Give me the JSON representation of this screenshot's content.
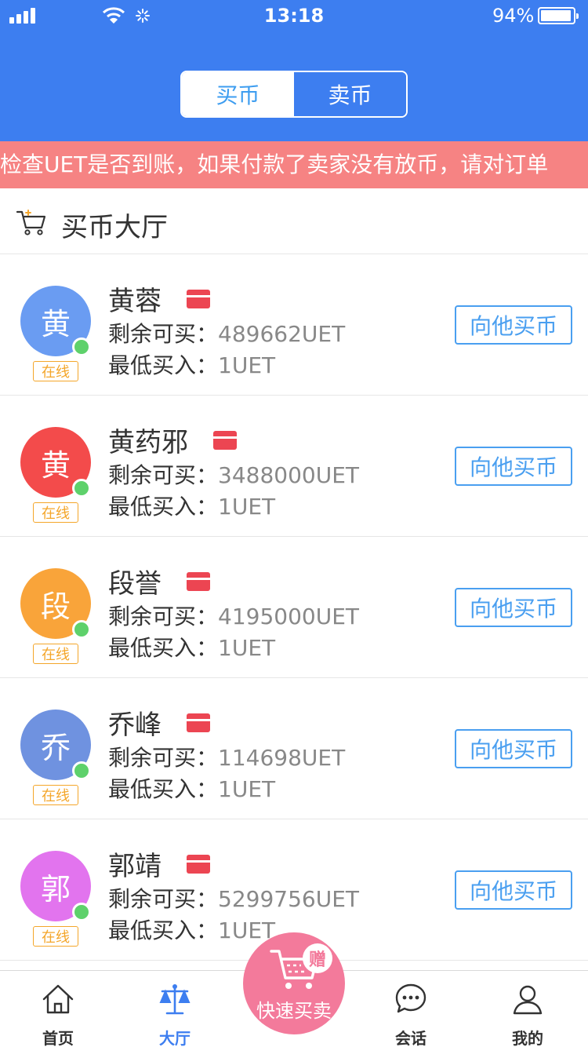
{
  "status_bar": {
    "time": "13:18",
    "battery_text": "94%",
    "battery_level": 0.94
  },
  "segment": {
    "buy_label": "买币",
    "sell_label": "卖币",
    "selected": "sell"
  },
  "notice": {
    "text": "检查UET是否到账，如果付款了卖家没有放币，请对订单"
  },
  "hall": {
    "title": "买币大厅",
    "icon": "cart-icon"
  },
  "labels": {
    "remaining": "剩余可买：",
    "min_buy": "最低买入：",
    "online": "在线",
    "buy_button": "向他买币"
  },
  "sellers": [
    {
      "avatar_char": "黄",
      "avatar_color": "#6a9cf2",
      "name": "黄蓉",
      "remaining": "489662UET",
      "min_buy": "1UET"
    },
    {
      "avatar_char": "黄",
      "avatar_color": "#f34b4b",
      "name": "黄药邪",
      "remaining": "3488000UET",
      "min_buy": "1UET"
    },
    {
      "avatar_char": "段",
      "avatar_color": "#f9a43a",
      "name": "段誉",
      "remaining": "4195000UET",
      "min_buy": "1UET"
    },
    {
      "avatar_char": "乔",
      "avatar_color": "#6f92e0",
      "name": "乔峰",
      "remaining": "114698UET",
      "min_buy": "1UET"
    },
    {
      "avatar_char": "郭",
      "avatar_color": "#e274ee",
      "name": "郭靖",
      "remaining": "5299756UET",
      "min_buy": "1UET"
    }
  ],
  "tabbar": {
    "items": [
      {
        "label": "首页",
        "icon": "home-icon"
      },
      {
        "label": "大厅",
        "icon": "scale-icon",
        "active": true
      },
      {
        "label": "会话",
        "icon": "chat-icon"
      },
      {
        "label": "我的",
        "icon": "profile-icon"
      }
    ],
    "fab": {
      "label": "快速买卖",
      "badge": "赠",
      "icon": "cart-icon"
    }
  },
  "colors": {
    "primary": "#3d7ef0",
    "notice_bg": "#f68383",
    "link": "#4a9ff0",
    "online": "#f4a62a",
    "online_dot": "#5ed16b",
    "fab": "#f37a9b",
    "card": "#ec4552"
  }
}
